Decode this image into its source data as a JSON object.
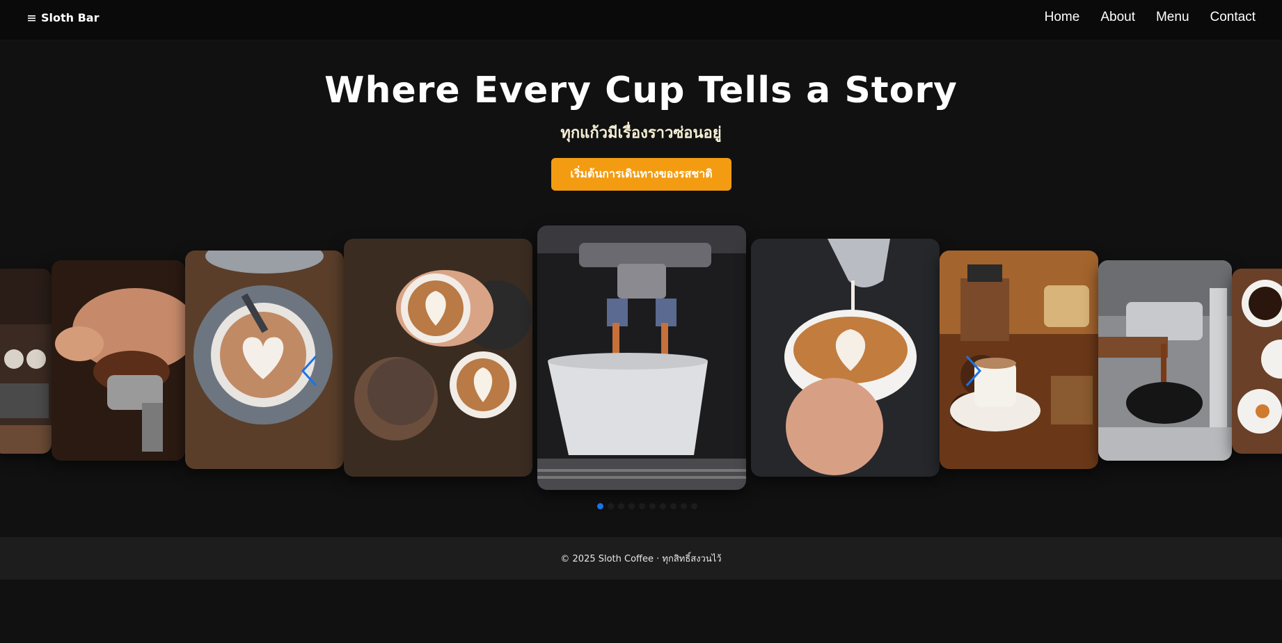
{
  "navbar": {
    "brand": "Sloth Bar",
    "menu_icon": "hamburger-icon",
    "links": [
      "Home",
      "About",
      "Menu",
      "Contact"
    ]
  },
  "hero": {
    "title": "Where Every Cup Tells a Story",
    "subtitle": "ทุกแก้วมีเรื่องราวซ่อนอยู่",
    "cta_label": "เริ่มต้นการเดินทางของรสชาติ"
  },
  "carousel": {
    "slide_count": 10,
    "active_slide": 1,
    "prev_icon": "chevron-left-icon",
    "next_icon": "chevron-right-icon",
    "accent_color": "#1a73e8"
  },
  "footer": {
    "text": "© 2025 Sloth Coffee · ทุกสิทธิ์สงวนไว้"
  },
  "colors": {
    "background": "#111111",
    "navbar": "#0a0a0a",
    "cta": "#f39c12",
    "footer": "#1d1d1d"
  }
}
